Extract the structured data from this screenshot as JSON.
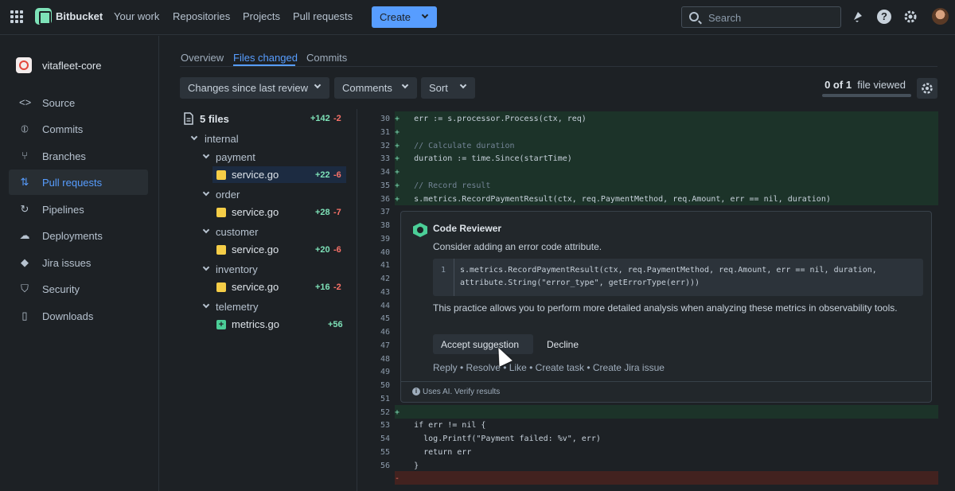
{
  "topnav": {
    "brand": "Bitbucket",
    "links": [
      "Your work",
      "Repositories",
      "Projects",
      "Pull requests"
    ],
    "create_label": "Create",
    "search_placeholder": "Search"
  },
  "sidebar": {
    "repo_name": "vitafleet-core",
    "items": [
      {
        "label": "Source",
        "icon": "code-icon"
      },
      {
        "label": "Commits",
        "icon": "commit-icon"
      },
      {
        "label": "Branches",
        "icon": "branch-icon"
      },
      {
        "label": "Pull requests",
        "icon": "pull-request-icon"
      },
      {
        "label": "Pipelines",
        "icon": "pipelines-icon"
      },
      {
        "label": "Deployments",
        "icon": "deployments-icon"
      },
      {
        "label": "Jira issues",
        "icon": "jira-icon"
      },
      {
        "label": "Security",
        "icon": "shield-icon"
      },
      {
        "label": "Downloads",
        "icon": "file-icon"
      }
    ],
    "selected": "Pull requests"
  },
  "tabs": [
    "Overview",
    "Files changed",
    "Commits"
  ],
  "active_tab": "Files changed",
  "filters": {
    "changes": "Changes since last review",
    "comments": "Comments",
    "sort": "Sort"
  },
  "viewed": {
    "count": "0 of 1",
    "label": "file viewed"
  },
  "filetree": {
    "summary": "5 files",
    "total_add": "+142",
    "total_del": "-2",
    "root": "internal",
    "folders": [
      {
        "name": "payment",
        "file": "service.go",
        "add": "+22",
        "del": "-6",
        "status": "modified"
      },
      {
        "name": "order",
        "file": "service.go",
        "add": "+28",
        "del": "-7",
        "status": "modified"
      },
      {
        "name": "customer",
        "file": "service.go",
        "add": "+20",
        "del": "-6",
        "status": "modified"
      },
      {
        "name": "inventory",
        "file": "service.go",
        "add": "+16",
        "del": "-2",
        "status": "modified"
      },
      {
        "name": "telemetry",
        "file": "metrics.go",
        "add": "+56",
        "del": "",
        "status": "added"
      }
    ]
  },
  "code": {
    "lines_top": [
      {
        "no": "30",
        "text": "  err := s.processor.Process(ctx, req)",
        "type": "add"
      },
      {
        "no": "31",
        "text": "",
        "type": "add"
      },
      {
        "no": "32",
        "text": "  // Calculate duration",
        "type": "add"
      },
      {
        "no": "33",
        "text": "  duration := time.Since(startTime)",
        "type": "add"
      },
      {
        "no": "34",
        "text": "",
        "type": "add"
      },
      {
        "no": "35",
        "text": "  // Record result",
        "type": "add"
      },
      {
        "no": "36",
        "text": "  s.metrics.RecordPaymentResult(ctx, req.PaymentMethod, req.Amount, err == nil, duration)",
        "type": "add"
      }
    ],
    "gutter_numbers": [
      "37",
      "38",
      "39",
      "40",
      "41",
      "42",
      "43",
      "44",
      "45",
      "46",
      "47",
      "48",
      "49",
      "50",
      "51"
    ],
    "lines_bottom": [
      {
        "no": "52",
        "text": "",
        "type": "add"
      },
      {
        "no": "53",
        "text": "  if err != nil {",
        "type": "ctx"
      },
      {
        "no": "54",
        "text": "    log.Printf(\"Payment failed: %v\", err)",
        "type": "ctx"
      },
      {
        "no": "55",
        "text": "    return err",
        "type": "ctx"
      },
      {
        "no": "56",
        "text": "  }",
        "type": "ctx"
      },
      {
        "no": "",
        "text": "",
        "type": "del"
      }
    ]
  },
  "review": {
    "author": "Code Reviewer",
    "message": "Consider adding an error code attribute.",
    "suggestion_line_no": "1",
    "suggestion_line1": "s.metrics.RecordPaymentResult(ctx, req.PaymentMethod, req.Amount, err == nil, duration,",
    "suggestion_line2": "attribute.String(\"error_type\", getErrorType(err)))",
    "explanation": "This practice allows you to perform more detailed analysis when analyzing these metrics in observability tools.",
    "accept_label": "Accept suggestion",
    "decline_label": "Decline",
    "actions": "Reply • Resolve • Like • Create task • Create Jira issue",
    "ai_note": "Uses AI. Verify results"
  }
}
